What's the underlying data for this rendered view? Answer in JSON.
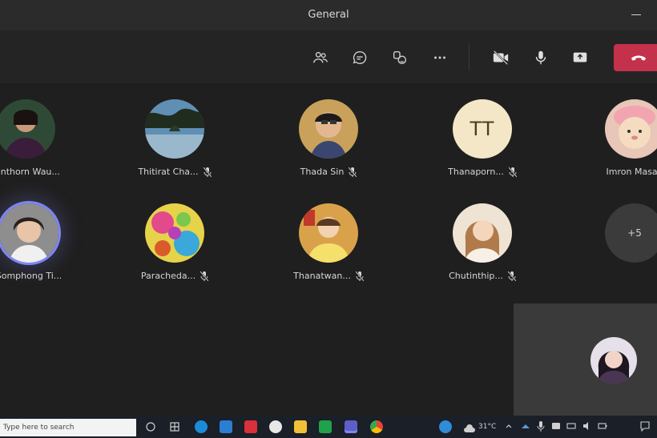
{
  "window": {
    "title": "General"
  },
  "toolbar": {
    "buttons": [
      {
        "name": "people-icon"
      },
      {
        "name": "chat-icon"
      },
      {
        "name": "reactions-icon"
      },
      {
        "name": "more-icon"
      },
      {
        "name": "camera-off-icon"
      },
      {
        "name": "microphone-icon"
      },
      {
        "name": "share-screen-icon"
      }
    ],
    "leave_icon": "phone-hangup-icon",
    "leave_color": "#c4314b"
  },
  "participants": [
    {
      "label": "Tanthorn Wau...",
      "avatar": "photo",
      "muted": false
    },
    {
      "label": "Thitirat Cha...",
      "avatar": "photo",
      "muted": true
    },
    {
      "label": "Thada Sin",
      "avatar": "photo",
      "muted": true
    },
    {
      "label": "Thanaporn...",
      "avatar": "initials",
      "initials": "TT",
      "muted": true
    },
    {
      "label": "Imron Masae",
      "avatar": "photo",
      "muted": false
    },
    {
      "label": "Somphong Ti...",
      "avatar": "photo",
      "muted": false,
      "speaking": true
    },
    {
      "label": "Paracheda...",
      "avatar": "photo",
      "muted": true
    },
    {
      "label": "Thanatwan...",
      "avatar": "photo",
      "muted": true
    },
    {
      "label": "Chutinthip...",
      "avatar": "photo",
      "muted": true
    },
    {
      "label": "+5",
      "avatar": "overflow",
      "muted": false
    }
  ],
  "self_view": {
    "avatar": "photo"
  },
  "taskbar": {
    "search_text": "Type here to search",
    "temperature": "31°C"
  },
  "colors": {
    "accent": "#7f85f5",
    "background": "#1f1f1f"
  }
}
